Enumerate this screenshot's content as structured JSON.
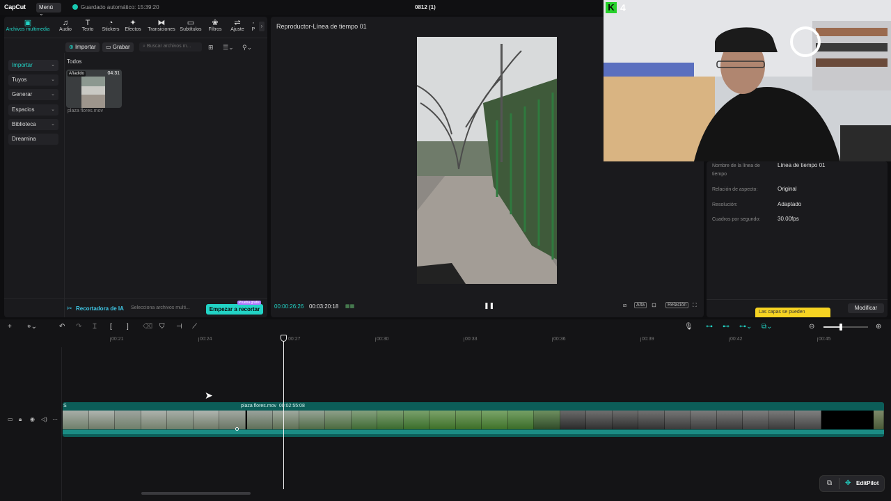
{
  "app": {
    "logo": "CapCut",
    "menu_label": "Menú",
    "autosave": "Guardado automático: 15:39:20",
    "project_name": "0812 (1)"
  },
  "media_tabs": [
    {
      "label": "Archivos multimedia",
      "icon": "media-icon"
    },
    {
      "label": "Audio",
      "icon": "audio-icon"
    },
    {
      "label": "Texto",
      "icon": "text-icon"
    },
    {
      "label": "Stickers",
      "icon": "sticker-icon"
    },
    {
      "label": "Efectos",
      "icon": "effects-icon"
    },
    {
      "label": "Transiciones",
      "icon": "transitions-icon"
    },
    {
      "label": "Subtítulos",
      "icon": "subtitles-icon"
    },
    {
      "label": "Filtros",
      "icon": "filters-icon"
    },
    {
      "label": "Ajuste",
      "icon": "adjust-icon"
    },
    {
      "label": "P",
      "icon": "more-icon"
    }
  ],
  "sidebar": [
    {
      "label": "Importar"
    },
    {
      "label": "Tuyos"
    },
    {
      "label": "Generar"
    },
    {
      "label": "Espacios"
    },
    {
      "label": "Biblioteca"
    },
    {
      "label": "Dreamina"
    }
  ],
  "media": {
    "import_btn": "Importar",
    "record_btn": "Grabar",
    "search_placeholder": "Buscar archivos m...",
    "section": "Todos",
    "clip": {
      "badge": "Añadido",
      "duration": "04:31",
      "name": "plaza flores.mov"
    }
  },
  "ai_cutter": {
    "title": "Recortadora de IA",
    "hint": "Selecciona archivos multi...",
    "start_btn": "Empezar a recortar",
    "badge": "Prueba gratis"
  },
  "player": {
    "title": "Reproductor-Línea de tiempo 01",
    "current_time": "00:00:26:26",
    "total_time": "00:03:20:18",
    "ratio_label": "Relación",
    "quality_label": "Alta"
  },
  "properties": {
    "rows": [
      {
        "key": "Nombre de la línea de tiempo",
        "value": "Línea de tiempo 01"
      },
      {
        "key": "Relación de aspecto:",
        "value": "Original"
      },
      {
        "key": "Resolución:",
        "value": "Adaptado"
      },
      {
        "key": "Cuadros por segundo:",
        "value": "30.00fps"
      }
    ],
    "modify_btn": "Modificar",
    "tooltip": "Las capas se pueden"
  },
  "webcam": {
    "badge_letter": "K",
    "badge_count": "4"
  },
  "timeline": {
    "ruler": [
      "00:21",
      "00:24",
      "00:27",
      "00:30",
      "00:33",
      "00:36",
      "00:39",
      "00:42",
      "00:45"
    ],
    "clip_name": "plaza flores.mov",
    "clip_duration": "00:02:55:08",
    "first_clip_label": "S"
  },
  "editpilot": {
    "label": "EditPilot"
  },
  "colors": {
    "accent": "#22d3c5",
    "clip": "#0c5d58",
    "tooltip": "#f6d322",
    "kick": "#27d12b"
  }
}
